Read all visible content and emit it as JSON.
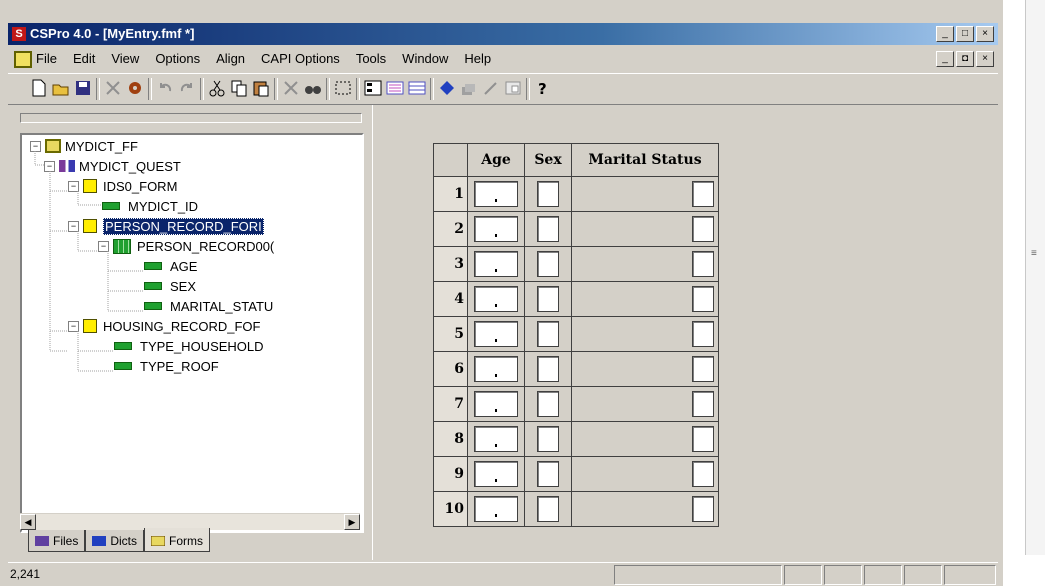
{
  "window": {
    "title": "CSPro 4.0 - [MyEntry.fmf *]",
    "app_icon_letter": "S",
    "caption_buttons": [
      "_",
      "□",
      "×"
    ],
    "mdi_buttons": [
      "_",
      "◘",
      "×"
    ]
  },
  "menu": {
    "items": [
      "File",
      "Edit",
      "View",
      "Options",
      "Align",
      "CAPI Options",
      "Tools",
      "Window",
      "Help"
    ]
  },
  "toolbar": {
    "icons": [
      "new-icon",
      "open-icon",
      "save-icon",
      "cut-tool-icon",
      "gear-icon",
      "undo-icon",
      "redo-icon",
      "scissors-icon",
      "copy-icon",
      "paste-icon",
      "delete-icon",
      "find-icon",
      "select-icon",
      "roster-icon",
      "field-icon",
      "grid-icon",
      "drop-icon",
      "stack-icon",
      "pencil-icon",
      "window-icon",
      "help-icon"
    ]
  },
  "tree": {
    "nodes": [
      {
        "label": "MYDICT_FF",
        "type": "dict",
        "expander": "−"
      },
      {
        "label": "MYDICT_QUEST",
        "type": "level",
        "expander": "−"
      },
      {
        "label": "IDS0_FORM",
        "type": "form",
        "expander": "−"
      },
      {
        "label": "MYDICT_ID",
        "type": "item",
        "expander": ""
      },
      {
        "label": "PERSON_RECORD_FORI",
        "type": "form",
        "expander": "−",
        "selected": true
      },
      {
        "label": "PERSON_RECORD00(",
        "type": "roster",
        "expander": "−"
      },
      {
        "label": "AGE",
        "type": "item",
        "expander": ""
      },
      {
        "label": "SEX",
        "type": "item",
        "expander": ""
      },
      {
        "label": "MARITAL_STATU",
        "type": "item",
        "expander": ""
      },
      {
        "label": "HOUSING_RECORD_FOF",
        "type": "form",
        "expander": "−"
      },
      {
        "label": "TYPE_HOUSEHOLD",
        "type": "item",
        "expander": ""
      },
      {
        "label": "TYPE_ROOF",
        "type": "item",
        "expander": ""
      }
    ]
  },
  "tabs": [
    {
      "label": "Files",
      "icon": "files-icon"
    },
    {
      "label": "Dicts",
      "icon": "dicts-icon"
    },
    {
      "label": "Forms",
      "icon": "forms-icon",
      "active": true
    }
  ],
  "roster": {
    "columns": [
      "Age",
      "Sex",
      "Marital Status"
    ],
    "rows": [
      "1",
      "2",
      "3",
      "4",
      "5",
      "6",
      "7",
      "8",
      "9",
      "10"
    ]
  },
  "status": {
    "text": "2,241"
  },
  "outer_scroll_glyph": "≡"
}
